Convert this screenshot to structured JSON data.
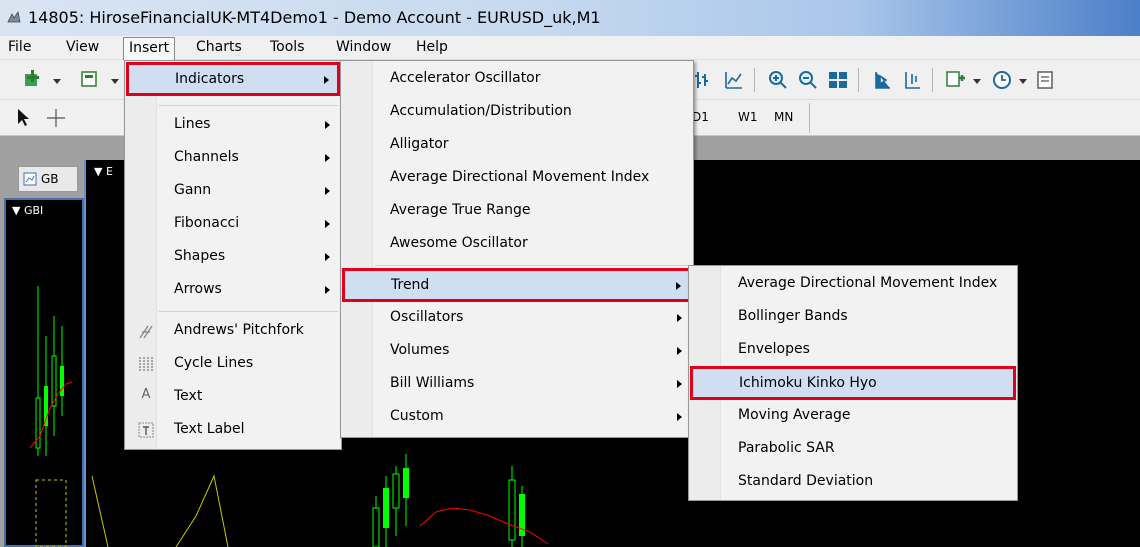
{
  "window": {
    "title": "14805: HiroseFinancialUK-MT4Demo1 - Demo Account - EURUSD_uk,M1"
  },
  "menubar": {
    "items": [
      "File",
      "View",
      "Insert",
      "Charts",
      "Tools",
      "Window",
      "Help"
    ]
  },
  "toolbar2": {
    "timeframes": [
      "D1",
      "W1",
      "MN"
    ]
  },
  "charts": {
    "tab_label": "GB",
    "left_title": "GBI",
    "main_title": "E"
  },
  "insert_menu": {
    "items": [
      {
        "label": "Indicators",
        "submenu": true
      },
      {
        "label": "Lines",
        "submenu": true
      },
      {
        "label": "Channels",
        "submenu": true
      },
      {
        "label": "Gann",
        "submenu": true
      },
      {
        "label": "Fibonacci",
        "submenu": true
      },
      {
        "label": "Shapes",
        "submenu": true
      },
      {
        "label": "Arrows",
        "submenu": true
      },
      {
        "label": "Andrews' Pitchfork",
        "icon": "pitchfork-icon"
      },
      {
        "label": "Cycle Lines",
        "icon": "cycle-lines-icon"
      },
      {
        "label": "Text",
        "icon": "text-icon"
      },
      {
        "label": "Text Label",
        "icon": "text-label-icon"
      }
    ]
  },
  "indicators_menu": {
    "items": [
      {
        "label": "Accelerator Oscillator"
      },
      {
        "label": "Accumulation/Distribution"
      },
      {
        "label": "Alligator"
      },
      {
        "label": "Average Directional Movement Index"
      },
      {
        "label": "Average True Range"
      },
      {
        "label": "Awesome Oscillator"
      },
      {
        "label": "Trend",
        "submenu": true
      },
      {
        "label": "Oscillators",
        "submenu": true
      },
      {
        "label": "Volumes",
        "submenu": true
      },
      {
        "label": "Bill Williams",
        "submenu": true
      },
      {
        "label": "Custom",
        "submenu": true
      }
    ]
  },
  "trend_menu": {
    "items": [
      {
        "label": "Average Directional Movement Index"
      },
      {
        "label": "Bollinger Bands"
      },
      {
        "label": "Envelopes"
      },
      {
        "label": "Ichimoku Kinko Hyo"
      },
      {
        "label": "Moving Average"
      },
      {
        "label": "Parabolic SAR"
      },
      {
        "label": "Standard Deviation"
      }
    ]
  },
  "colors": {
    "highlight": "#cfdff1",
    "annotation_red": "#e0001b",
    "chart_bg": "#000000",
    "candle": "#00ff00",
    "ma_red": "#ff0000",
    "line_yellow": "#c8c800"
  }
}
